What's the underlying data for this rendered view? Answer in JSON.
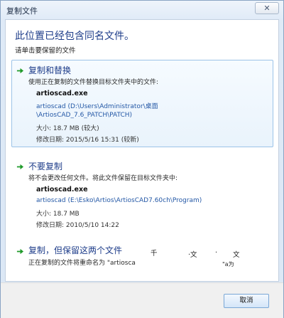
{
  "window": {
    "title": "复制文件",
    "close_glyph": "✕"
  },
  "dialog": {
    "heading": "此位置已经包含同名文件。",
    "subheading": "请单击要保留的文件"
  },
  "options": {
    "copy_replace": {
      "title": "复制和替换",
      "description": "使用正在复制的文件替换目标文件夹中的文件:",
      "file_name": "artioscad.exe",
      "path_line1": "artioscad (D:\\Users\\Administrator\\桌面",
      "path_line2": "\\ArtiosCAD_7.6_PATCH\\PATCH)",
      "size": "大小: 18.7 MB (较大)",
      "modified": "修改日期: 2015/5/16 15:31 (较新)"
    },
    "dont_copy": {
      "title": "不要复制",
      "description": "将不会更改任何文件。将此文件保留在目标文件夹中:",
      "file_name": "artioscad.exe",
      "path_line1": "artioscad (E:\\Esko\\Artios\\ArtiosCAD7.60ch\\Program)",
      "size": "大小: 18.7 MB",
      "modified": "修改日期: 2010/5/10 14:22"
    },
    "keep_both": {
      "title": "复制，但保留这两个文件",
      "description": "正在复制的文件将重命名为 \"artiosca",
      "glitch_1": "千",
      "glitch_2": "·文",
      "glitch_3": "·",
      "glitch_4": "文",
      "glitch_5": "\"a为"
    }
  },
  "footer": {
    "cancel_label": "取消"
  },
  "colors": {
    "heading": "#1e3d8a",
    "path_text": "#2458a6",
    "arrow_green": "#1f9a2a",
    "selected_border": "#9cc3e8"
  },
  "icons": {
    "option_arrow": "green-right-arrow-icon",
    "close": "close-icon"
  }
}
